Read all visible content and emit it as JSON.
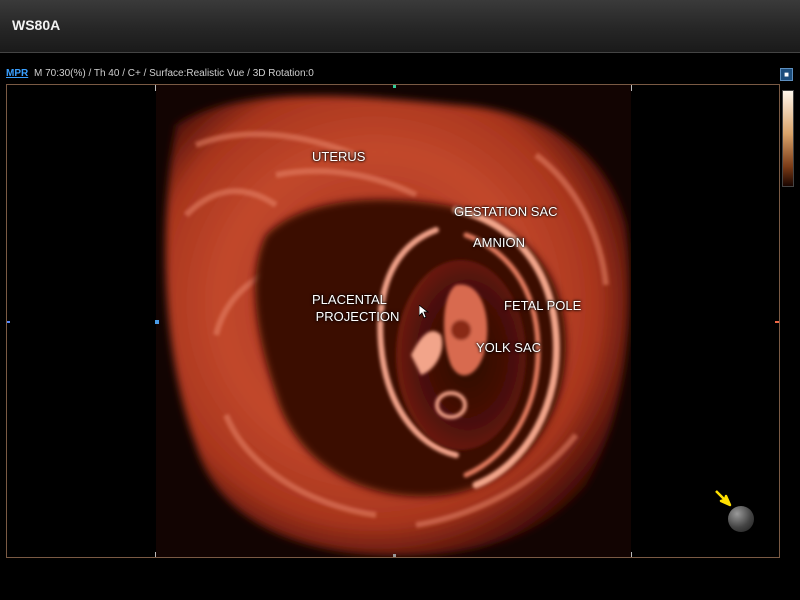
{
  "app": {
    "title": "WS80A"
  },
  "infobar": {
    "mode": "MPR",
    "params": "M 70:30(%) / Th 40 / C+ / Surface:Realistic Vue / 3D Rotation:0"
  },
  "annotations": {
    "uterus": "UTERUS",
    "gestation_sac": "GESTATION SAC",
    "amnion": "AMNION",
    "placental_projection": "PLACENTAL\n PROJECTION",
    "fetal_pole": "FETAL POLE",
    "yolk_sac": "YOLK SAC"
  },
  "colors": {
    "tissue_light": "#e8856a",
    "tissue_mid": "#b8402a",
    "tissue_dark": "#5a1208",
    "mpr_link": "#3aa0ff",
    "indicator_arrow": "#ffe000"
  },
  "icons": {
    "corner_square": "square-icon",
    "trackball": "trackball-icon",
    "indicator": "arrow-icon",
    "pointer": "mouse-cursor-icon"
  }
}
